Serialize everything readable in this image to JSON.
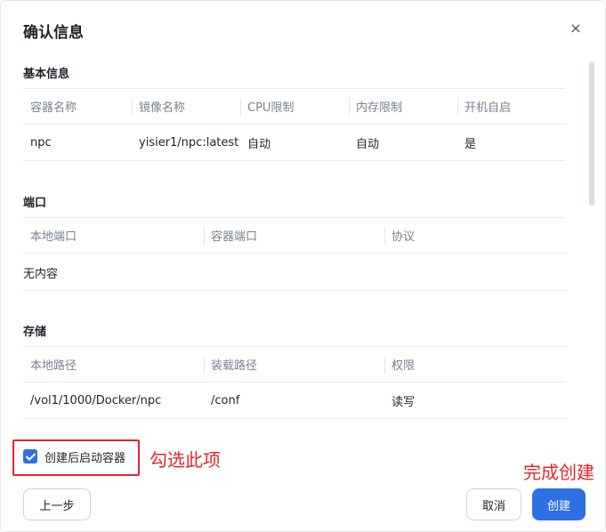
{
  "dialog": {
    "title": "确认信息",
    "close_symbol": "×"
  },
  "basic": {
    "title": "基本信息",
    "headers": [
      "容器名称",
      "镜像名称",
      "CPU限制",
      "内存限制",
      "开机自启"
    ],
    "row": [
      "npc",
      "yisier1/npc:latest",
      "自动",
      "自动",
      "是"
    ]
  },
  "ports": {
    "title": "端口",
    "headers": [
      "本地端口",
      "容器端口",
      "协议"
    ],
    "empty_text": "无内容"
  },
  "storage": {
    "title": "存储",
    "headers": [
      "本地路径",
      "装载路径",
      "权限"
    ],
    "row": [
      "/vol1/1000/Docker/npc",
      "/conf",
      "读写"
    ]
  },
  "start_after_create": {
    "label": "创建后启动容器",
    "checked": true
  },
  "annotations": {
    "check_hint": "勾选此项",
    "finish_hint": "完成创建",
    "color": "#e5262a"
  },
  "buttons": {
    "prev": "上一步",
    "cancel": "取消",
    "create": "创建"
  },
  "colors": {
    "accent": "#2f6fe4"
  }
}
